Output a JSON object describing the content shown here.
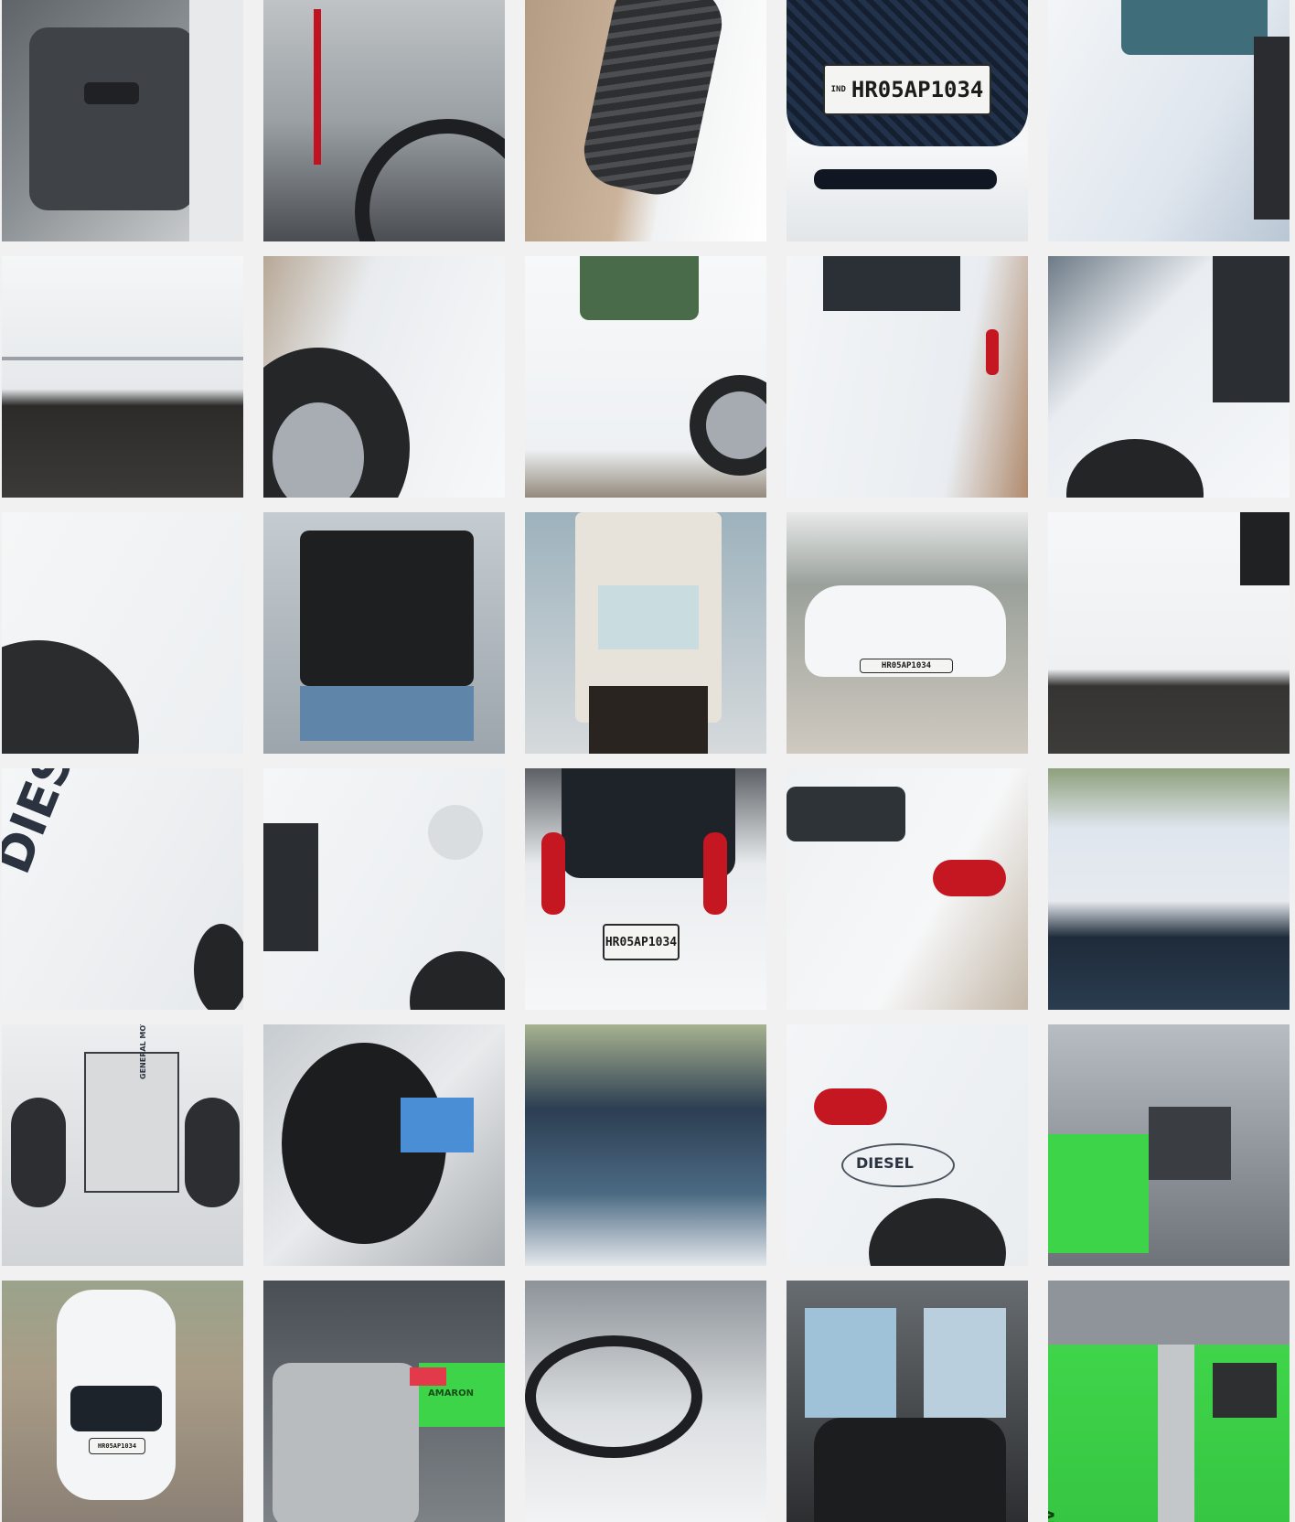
{
  "gallery": {
    "photos": [
      {
        "id": "interior-door"
      },
      {
        "id": "dashboard-steering"
      },
      {
        "id": "tyre-closeup"
      },
      {
        "id": "front-grille-plate",
        "plate_text": "HR05AP1034",
        "plate_country": "IND"
      },
      {
        "id": "rear-door-panel"
      },
      {
        "id": "lower-door-sill"
      },
      {
        "id": "front-wheel-arch"
      },
      {
        "id": "side-rear-door"
      },
      {
        "id": "side-rear-quarter"
      },
      {
        "id": "rear-wheel-arch"
      },
      {
        "id": "rear-fender-tyre"
      },
      {
        "id": "bonnet-open"
      },
      {
        "id": "tailgate-open"
      },
      {
        "id": "front-view-street",
        "plate_text": "HR05AP1034"
      },
      {
        "id": "door-lower-panel"
      },
      {
        "id": "diesel-decal",
        "decal_text": "DIESEL"
      },
      {
        "id": "front-headlight-side"
      },
      {
        "id": "rear-view-plate",
        "plate_text": "HR05AP1034"
      },
      {
        "id": "rear-quarter-taillight"
      },
      {
        "id": "roof-windscreen"
      },
      {
        "id": "vin-plate",
        "plate_text": "GENERAL MOTORS INDIA PVT LTD"
      },
      {
        "id": "instrument-cluster"
      },
      {
        "id": "windscreen-reflection"
      },
      {
        "id": "rear-diesel-badge",
        "decal_text": "DIESEL"
      },
      {
        "id": "engine-battery"
      },
      {
        "id": "front-full-view",
        "plate_text": "HR05AP1034"
      },
      {
        "id": "engine-bay-intake",
        "brand_text": "AMARON"
      },
      {
        "id": "driver-cockpit"
      },
      {
        "id": "rear-seats"
      },
      {
        "id": "battery-closeup",
        "brand_text": "AMARON"
      }
    ]
  },
  "colors": {
    "background": "#f1f1f1",
    "car_white": "#eef1f4",
    "asphalt": "#3c3a38",
    "battery_green": "#3ed449",
    "taillight_red": "#c41722"
  }
}
